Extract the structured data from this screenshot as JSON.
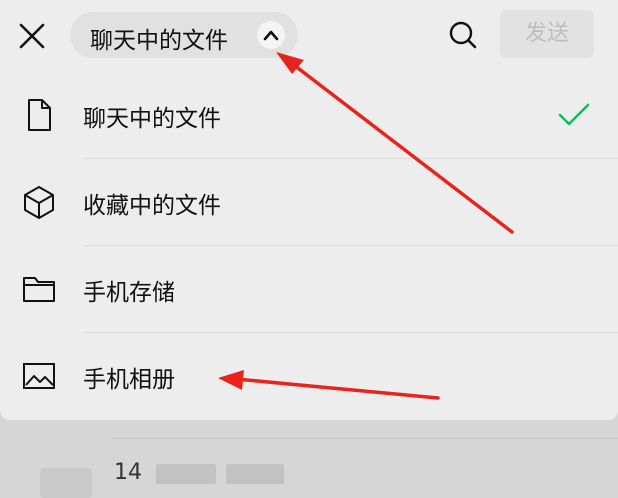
{
  "header": {
    "close_icon": "close-icon",
    "source_selector_label": "聊天中的文件",
    "source_selector_icon": "chevron-up-icon",
    "search_icon": "search-icon",
    "send_label": "发送",
    "send_enabled": false
  },
  "menu": {
    "items": [
      {
        "label": "聊天中的文件",
        "icon": "document-icon",
        "selected": true
      },
      {
        "label": "收藏中的文件",
        "icon": "cube-icon",
        "selected": false
      },
      {
        "label": "手机存储",
        "icon": "folder-icon",
        "selected": false
      },
      {
        "label": "手机相册",
        "icon": "image-icon",
        "selected": false
      }
    ],
    "selected_icon": "checkmark-icon"
  },
  "background_list": {
    "partial_text": "14 "
  },
  "colors": {
    "accent_check": "#07c160",
    "annotation_arrow": "#e8231c",
    "sheet_bg": "#ededed",
    "send_disabled_bg": "#e2e2e2",
    "send_disabled_text": "#bdbdbd"
  }
}
